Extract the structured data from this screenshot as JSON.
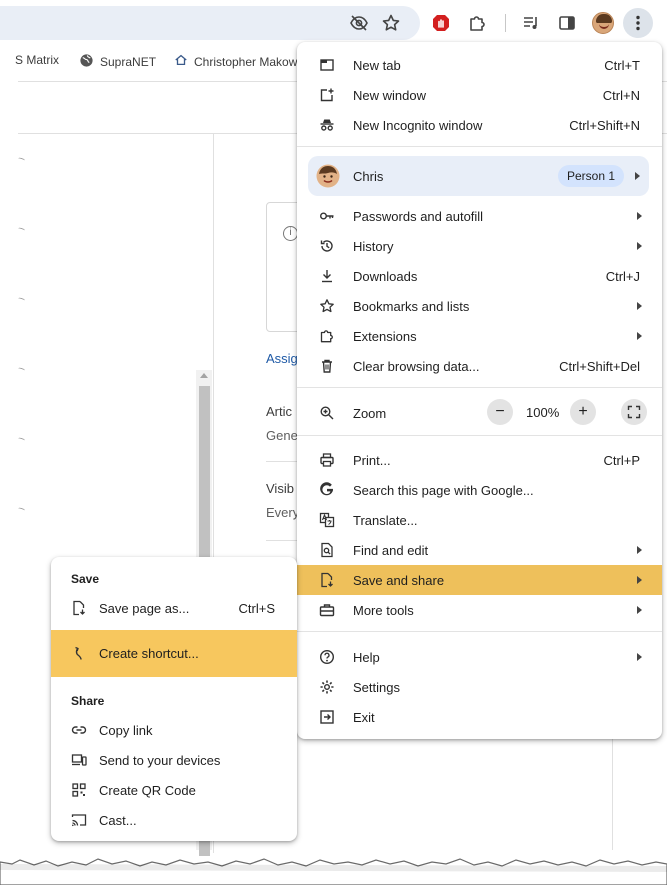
{
  "colors": {
    "highlight": "#eec05b",
    "submenu_highlight": "#f7c75e",
    "profile_bg": "#e8eef8",
    "badge_bg": "#d3e3fd",
    "link": "#1f5aa6"
  },
  "toolbar": {
    "icons": [
      "eye-off-icon",
      "star-icon",
      "red-extension-icon",
      "puzzle-icon",
      "media-queue-icon",
      "side-panel-icon",
      "profile-avatar",
      "kebab-menu-icon"
    ]
  },
  "bookmarks": [
    {
      "label": "S Matrix",
      "icon": ""
    },
    {
      "label": "SupraNET",
      "icon": "globe-icon"
    },
    {
      "label": "Christopher Makow",
      "icon": "home-icon"
    }
  ],
  "background": {
    "link": "Assig",
    "section1_heading": "Artic",
    "section1_value": "Gene",
    "section2_heading": "Visib",
    "section2_value": "Every"
  },
  "menu": {
    "new_tab": {
      "label": "New tab",
      "shortcut": "Ctrl+T"
    },
    "new_window": {
      "label": "New window",
      "shortcut": "Ctrl+N"
    },
    "incognito": {
      "label": "New Incognito window",
      "shortcut": "Ctrl+Shift+N"
    },
    "profile": {
      "name": "Chris",
      "badge": "Person 1"
    },
    "passwords": {
      "label": "Passwords and autofill"
    },
    "history": {
      "label": "History"
    },
    "downloads": {
      "label": "Downloads",
      "shortcut": "Ctrl+J"
    },
    "bookmarks": {
      "label": "Bookmarks and lists"
    },
    "extensions": {
      "label": "Extensions"
    },
    "clear": {
      "label": "Clear browsing data...",
      "shortcut": "Ctrl+Shift+Del"
    },
    "zoom": {
      "label": "Zoom",
      "minus": "−",
      "value": "100%",
      "plus": "+"
    },
    "print": {
      "label": "Print...",
      "shortcut": "Ctrl+P"
    },
    "search_google": {
      "label": "Search this page with Google..."
    },
    "translate": {
      "label": "Translate..."
    },
    "find_edit": {
      "label": "Find and edit"
    },
    "save_share": {
      "label": "Save and share"
    },
    "more_tools": {
      "label": "More tools"
    },
    "help": {
      "label": "Help"
    },
    "settings": {
      "label": "Settings"
    },
    "exit": {
      "label": "Exit"
    }
  },
  "submenu": {
    "save_heading": "Save",
    "save_page": {
      "label": "Save page as...",
      "shortcut": "Ctrl+S"
    },
    "create_shortcut": {
      "label": "Create shortcut..."
    },
    "share_heading": "Share",
    "copy_link": {
      "label": "Copy link"
    },
    "send_devices": {
      "label": "Send to your devices"
    },
    "qr_code": {
      "label": "Create QR Code"
    },
    "cast": {
      "label": "Cast..."
    }
  }
}
